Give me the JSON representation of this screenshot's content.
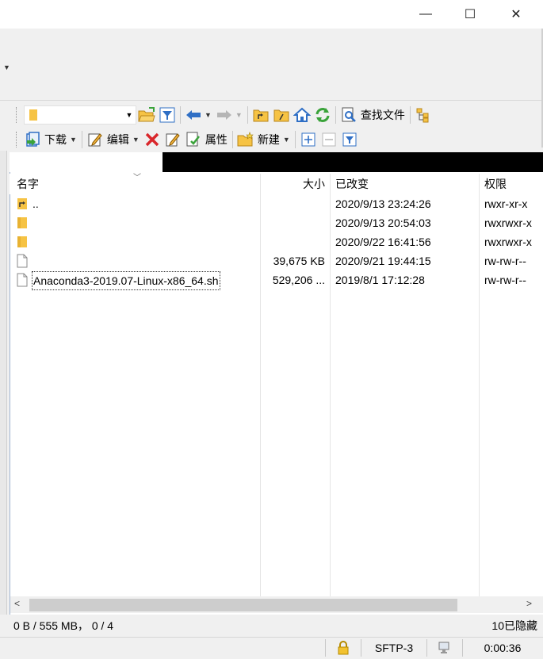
{
  "window": {
    "minimize_glyph": "—",
    "maximize_glyph": "☐",
    "close_glyph": "✕"
  },
  "toolbar1": {
    "path_value": "",
    "find_files_label": "查找文件"
  },
  "toolbar2": {
    "download_label": "下载",
    "edit_label": "编辑",
    "properties_label": "属性",
    "new_label": "新建"
  },
  "columns": {
    "name": "名字",
    "size": "大小",
    "modified": "已改变",
    "permissions": "权限"
  },
  "files": [
    {
      "icon": "parent-folder-icon",
      "name": "..",
      "size": "",
      "modified": "2020/9/13 23:24:26",
      "permissions": "rwxr-xr-x"
    },
    {
      "icon": "folder-icon",
      "name": "",
      "size": "",
      "modified": "2020/9/13 20:54:03",
      "permissions": "rwxrwxr-x"
    },
    {
      "icon": "folder-icon",
      "name": "",
      "size": "",
      "modified": "2020/9/22 16:41:56",
      "permissions": "rwxrwxr-x"
    },
    {
      "icon": "file-icon",
      "name": "",
      "size": "39,675 KB",
      "modified": "2020/9/21 19:44:15",
      "permissions": "rw-rw-r--"
    },
    {
      "icon": "file-icon",
      "name": "Anaconda3-2019.07-Linux-x86_64.sh",
      "size": "529,206 ...",
      "modified": "2019/8/1 17:12:28",
      "permissions": "rw-rw-r--"
    }
  ],
  "status": {
    "selection": "0 B / 555 MB， 0 / 4",
    "hidden": "10已隐藏",
    "protocol": "SFTP-3",
    "elapsed": "0:00:36"
  },
  "colors": {
    "folder": "#f6c344",
    "accent_blue": "#2f6fc5",
    "delete_red": "#d9262b",
    "refresh_green": "#3aa33a"
  }
}
